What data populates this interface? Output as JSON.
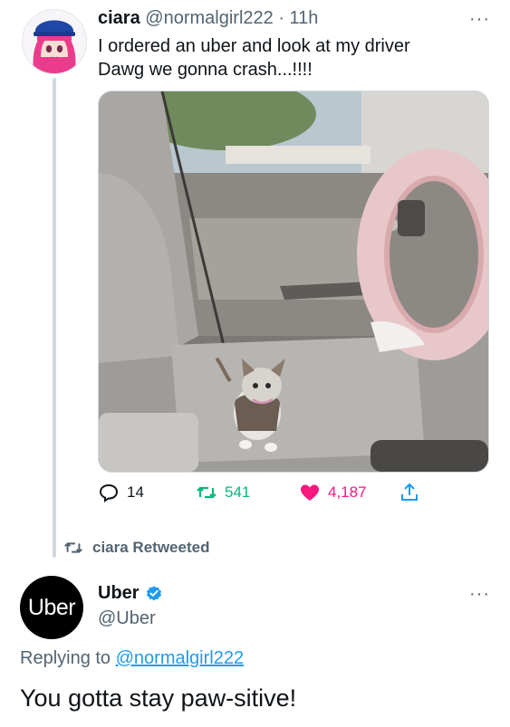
{
  "tweet": {
    "name": "ciara",
    "handle": "@normalgirl222",
    "separator": " · ",
    "time": "11h",
    "lines": [
      "I ordered an uber and look at my driver",
      "Dawg we gonna crash...!!!!"
    ],
    "more_label": "···",
    "replies": "14",
    "retweets": "541",
    "likes": "4,187"
  },
  "retweet_notice": "ciara Retweeted",
  "reply": {
    "avatar_text": "Uber",
    "name": "Uber",
    "handle": "@Uber",
    "more_label": "···",
    "replying_to_prefix": "Replying to ",
    "replying_to_handle": "@normalgirl222",
    "text": "You gotta stay paw-sitive!"
  },
  "colors": {
    "retweet": "#00ba7c",
    "like": "#f91880",
    "link": "#1d9bf0",
    "verified": "#1d9bf0",
    "secondary_text": "#536471"
  },
  "icons": [
    "reply-icon",
    "retweet-icon",
    "heart-icon",
    "share-icon",
    "verified-badge-icon",
    "more-icon"
  ]
}
